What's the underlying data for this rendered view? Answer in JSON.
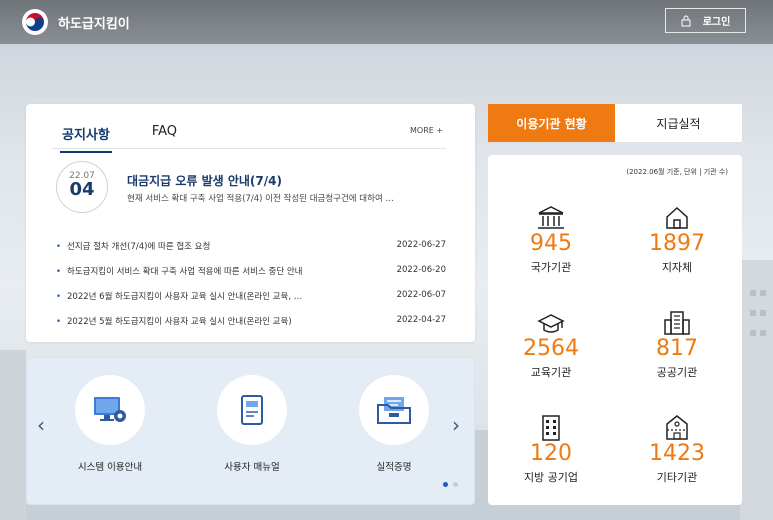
{
  "header": {
    "brand": "하도급지킴이",
    "login_label": "로그인"
  },
  "notice": {
    "tabs": [
      "공지사항",
      "FAQ"
    ],
    "more_label": "MORE +",
    "featured": {
      "date_ym": "22.07",
      "date_day": "04",
      "title": "대금지급 오류 발생 안내(7/4)",
      "description": "현재 서비스 확대 구축 사업 적용(7/4) 이전 작성된 대금청구건에 대하여 …"
    },
    "items": [
      {
        "title": "선지급 절차 개선(7/4)에 따른 협조 요청",
        "date": "2022-06-27"
      },
      {
        "title": "하도급지킴이 서비스 확대 구축 사업 적용에 따른 서비스 중단 안내",
        "date": "2022-06-20"
      },
      {
        "title": "2022년 6월 하도급지킴이 사용자 교육 실시 안내(온라인 교육, …",
        "date": "2022-06-07"
      },
      {
        "title": "2022년 5월 하도급지킴이 사용자 교육 실시 안내(온라인 교육)",
        "date": "2022-04-27"
      }
    ]
  },
  "shortcuts": {
    "items": [
      {
        "label": "시스템 이용안내",
        "icon": "monitor-gear-icon"
      },
      {
        "label": "사용자 매뉴얼",
        "icon": "book-icon"
      },
      {
        "label": "실적증명",
        "icon": "folder-icon"
      }
    ],
    "prev_arrow": "‹",
    "next_arrow": "›"
  },
  "stats": {
    "tabs": [
      "이용기관 현황",
      "지급실적"
    ],
    "note": "(2022.06월 기준, 단위 | 기관 수)",
    "accent_color": "#f07a12",
    "items": [
      {
        "value": "945",
        "label": "국가기관",
        "icon": "government-building-icon"
      },
      {
        "value": "1897",
        "label": "지자체",
        "icon": "house-icon"
      },
      {
        "value": "2564",
        "label": "교육기관",
        "icon": "graduation-cap-icon"
      },
      {
        "value": "817",
        "label": "공공기관",
        "icon": "office-building-icon"
      },
      {
        "value": "120",
        "label": "지방 공기업",
        "icon": "tower-building-icon"
      },
      {
        "value": "1423",
        "label": "기타기관",
        "icon": "misc-building-icon"
      }
    ]
  }
}
